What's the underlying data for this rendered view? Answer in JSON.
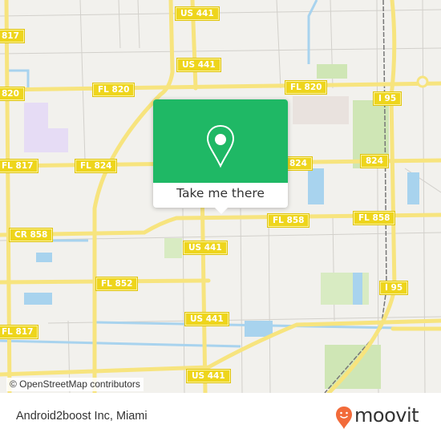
{
  "map": {
    "road_labels": [
      {
        "text": "US 441",
        "name": "shield-us441-north"
      },
      {
        "text": "817",
        "name": "shield-fl817-north"
      },
      {
        "text": "US 441",
        "name": "shield-us441-upper"
      },
      {
        "text": "820",
        "name": "shield-fl820-west"
      },
      {
        "text": "FL 820",
        "name": "shield-fl820-mid"
      },
      {
        "text": "FL 820",
        "name": "shield-fl820-east"
      },
      {
        "text": "I 95",
        "name": "shield-i95-north"
      },
      {
        "text": "FL 817",
        "name": "shield-fl817-mid"
      },
      {
        "text": "FL 824",
        "name": "shield-fl824-west"
      },
      {
        "text": "824",
        "name": "shield-824-center"
      },
      {
        "text": "824",
        "name": "shield-824-east"
      },
      {
        "text": "CR 858",
        "name": "shield-cr858"
      },
      {
        "text": "FL 858",
        "name": "shield-fl858-center"
      },
      {
        "text": "FL 858",
        "name": "shield-fl858-east"
      },
      {
        "text": "US 441",
        "name": "shield-us441-center"
      },
      {
        "text": "FL 852",
        "name": "shield-fl852"
      },
      {
        "text": "I 95",
        "name": "shield-i95-south"
      },
      {
        "text": "US 441",
        "name": "shield-us441-lower"
      },
      {
        "text": "FL 817",
        "name": "shield-fl817-south"
      },
      {
        "text": "US 441",
        "name": "shield-us441-south"
      }
    ],
    "attribution": "© OpenStreetMap contributors"
  },
  "popup": {
    "icon": "map-pin-icon",
    "label": "Take me there",
    "accent_color": "#1fb865"
  },
  "footer": {
    "place_name": "Android2boost Inc, Miami",
    "brand": "moovit",
    "brand_color": "#f26b3a"
  }
}
